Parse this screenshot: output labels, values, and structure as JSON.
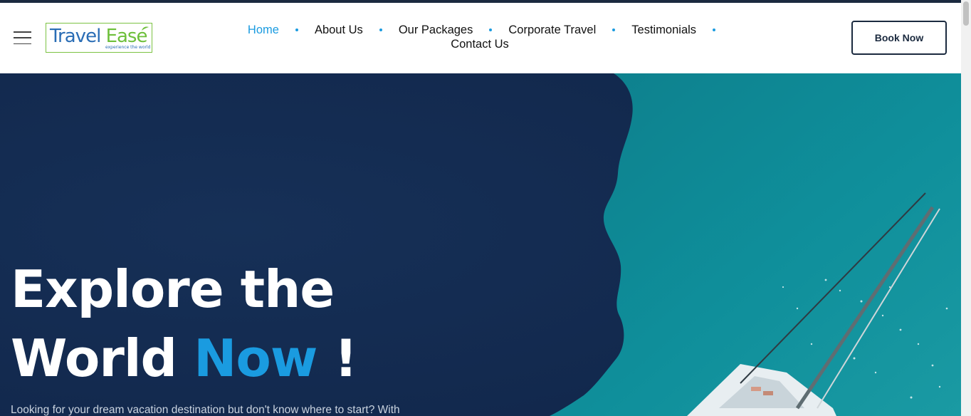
{
  "logo": {
    "word1": "Travel",
    "word2": "Ease",
    "tagline": "experience the world"
  },
  "nav": {
    "items": [
      {
        "label": "Home",
        "active": true
      },
      {
        "label": "About Us"
      },
      {
        "label": "Our Packages"
      },
      {
        "label": "Corporate Travel"
      },
      {
        "label": "Testimonials"
      },
      {
        "label": "Contact Us"
      }
    ]
  },
  "header": {
    "book_label": "Book Now"
  },
  "hero": {
    "title_line1": "Explore the",
    "title_line2_prefix": "World",
    "title_accent": "Now",
    "title_suffix": "!",
    "subtitle": "Looking for your dream vacation destination but don't know where to start? With"
  },
  "colors": {
    "accent": "#1a9be0",
    "navy": "#13294a",
    "sea": "#0f8a9a"
  },
  "icons": {
    "menu": "hamburger-menu-icon"
  }
}
